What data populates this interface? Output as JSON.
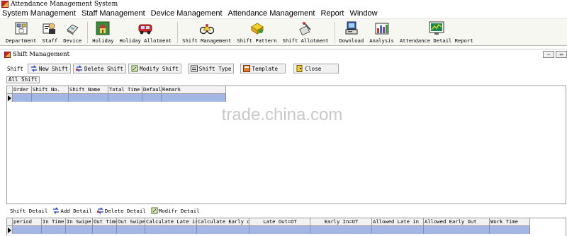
{
  "app": {
    "title": "Attendance Management System"
  },
  "menu": [
    "System Management",
    "Staff Management",
    "Device Management",
    "Attendance Management",
    "Report",
    "Window"
  ],
  "toolbar": {
    "buttons": [
      {
        "label": "Department",
        "icon": "department-icon"
      },
      {
        "label": "Staff",
        "icon": "staff-icon"
      },
      {
        "label": "Device",
        "icon": "device-icon"
      },
      {
        "label": "Holiday",
        "icon": "holiday-icon"
      },
      {
        "label": "Holiday Allotment",
        "icon": "holiday-allotment-icon"
      },
      {
        "label": "Shift Management",
        "icon": "shift-management-icon"
      },
      {
        "label": "Shift Pattern",
        "icon": "shift-pattern-icon"
      },
      {
        "label": "Shift Allotment",
        "icon": "shift-allotment-icon"
      },
      {
        "label": "Download",
        "icon": "download-icon"
      },
      {
        "label": "Analysis",
        "icon": "analysis-icon"
      },
      {
        "label": "Attendance Detail Report",
        "icon": "attendance-detail-report-icon"
      }
    ]
  },
  "window": {
    "title": "Shift Management",
    "shift_toolbar": {
      "shift_label": "Shift",
      "new_shift": "New Shift",
      "delete_shift": "Delete Shift",
      "modify_shift": "Modify Shift",
      "shift_type": "Shift Type",
      "template": "Template",
      "close": "Close"
    },
    "tab_all_shift": "All Shift",
    "shift_table": {
      "columns": [
        "Order",
        "Shift No.",
        "Shift Name",
        "Total Time",
        "Defaul",
        "Remark"
      ]
    },
    "watermark": "trade.china.com",
    "detail_toolbar": {
      "shift_detail": "Shift Detail",
      "add_detail": "Add Detail",
      "delete_detail": "Delete Detail",
      "modify_detail": "Modifr Detail"
    },
    "detail_table": {
      "columns": [
        "period",
        "In Time",
        "In Swipe",
        "Out Time",
        "Out Swipe",
        "Calculate Late in",
        "Calculate Early ou",
        "Late Out=OT",
        "Early In=OT",
        "Allowed Late in",
        "Allowed Early Out",
        "Work Time"
      ]
    }
  },
  "colors": {
    "selection": "#a4b6e3",
    "toolbar_bg": "#f7f7f2"
  }
}
